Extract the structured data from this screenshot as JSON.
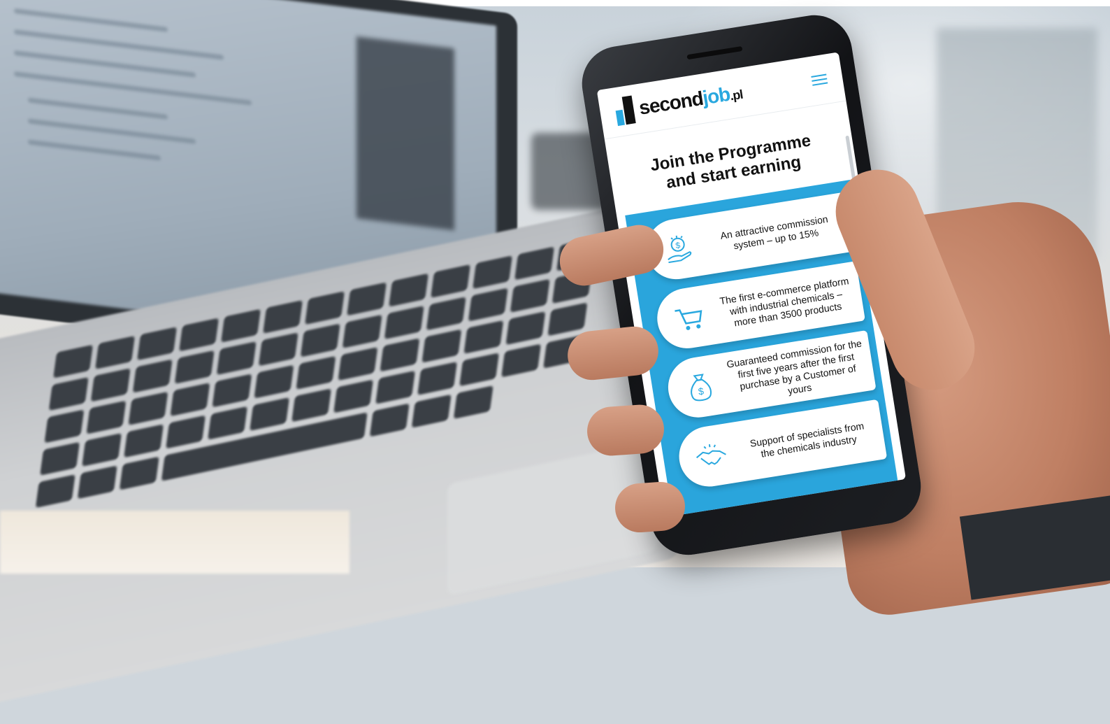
{
  "site": {
    "logo_text_a": "second",
    "logo_text_b": "job",
    "logo_text_c": ".pl",
    "brand_color": "#29a8df"
  },
  "hero": {
    "title_line1": "Join the Programme",
    "title_line2": "and start earning"
  },
  "features": [
    {
      "icon": "money-hand-icon",
      "text_line1": "An attractive commission",
      "text_line2": "system – up to 15%",
      "text_line3": ""
    },
    {
      "icon": "shopping-cart-icon",
      "text_line1": "The first e-commerce platform",
      "text_line2": "with industrial chemicals –",
      "text_line3": "more than 3500 products"
    },
    {
      "icon": "money-bag-icon",
      "text_line1": "Guaranteed commission for the",
      "text_line2": "first five years after the first",
      "text_line3": "purchase by a Customer of yours"
    },
    {
      "icon": "handshake-icon",
      "text_line1": "Support of specialists from",
      "text_line2": "the chemicals industry",
      "text_line3": ""
    }
  ]
}
